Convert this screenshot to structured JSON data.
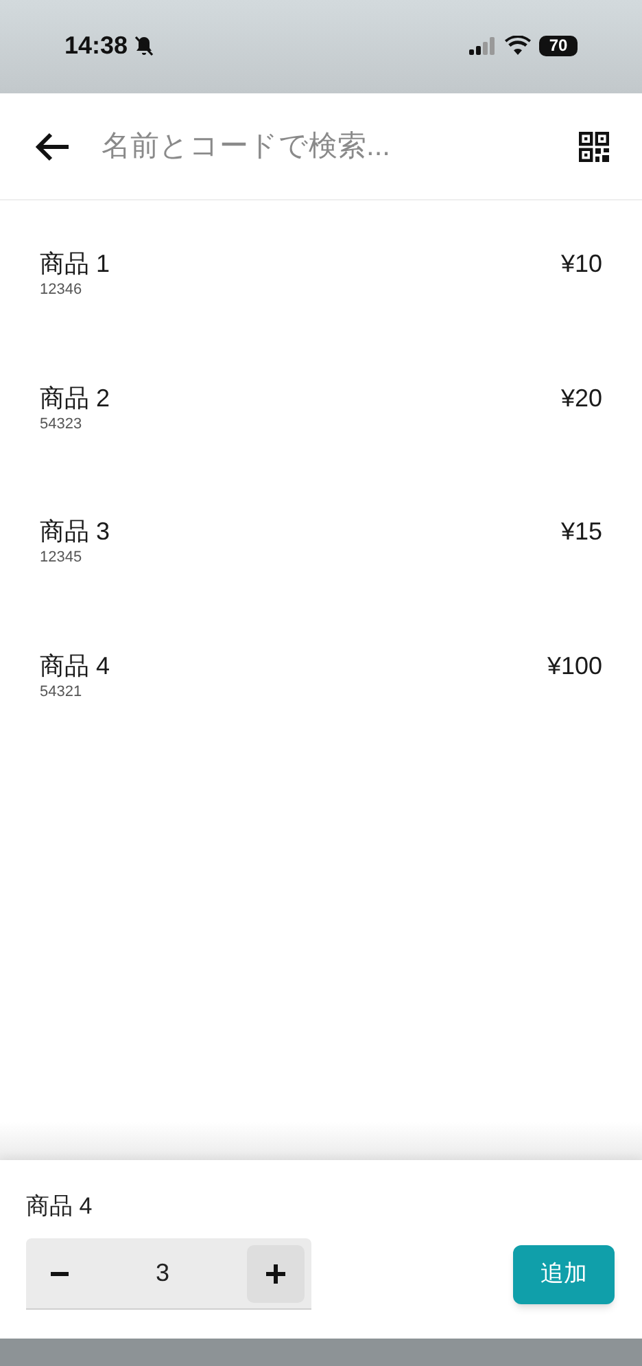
{
  "status_bar": {
    "time": "14:38",
    "battery": "70"
  },
  "search": {
    "placeholder": "名前とコードで検索..."
  },
  "products": [
    {
      "name": "商品 1",
      "code": "12346",
      "price": "¥10"
    },
    {
      "name": "商品 2",
      "code": "54323",
      "price": "¥20"
    },
    {
      "name": "商品 3",
      "code": "12345",
      "price": "¥15"
    },
    {
      "name": "商品 4",
      "code": "54321",
      "price": "¥100"
    }
  ],
  "selection": {
    "name": "商品 4",
    "quantity": "3",
    "add_button": "追加"
  }
}
